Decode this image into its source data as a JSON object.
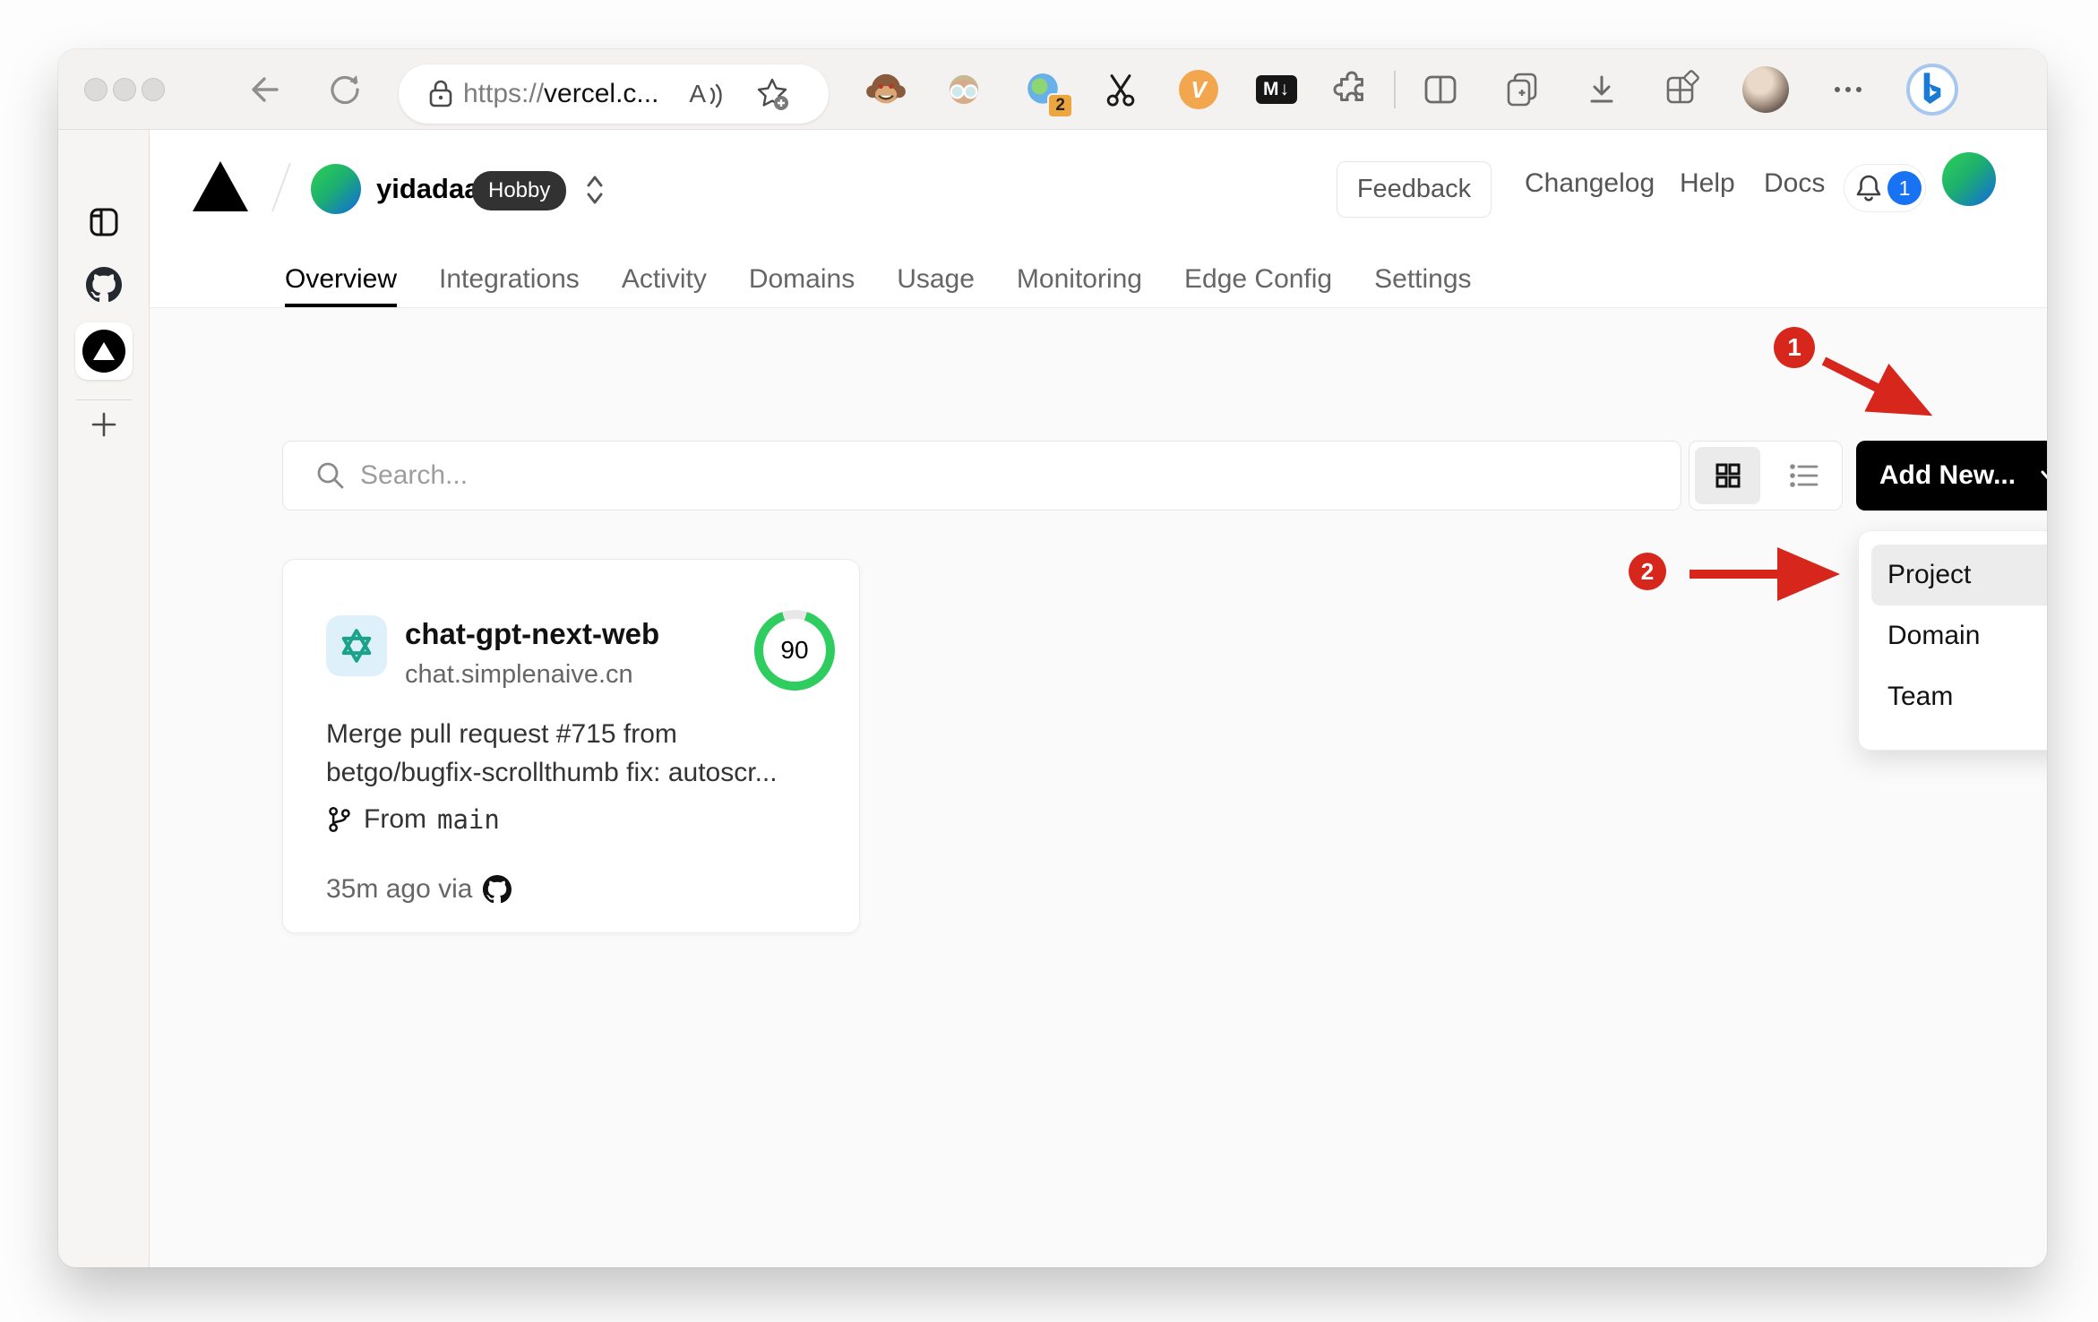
{
  "browser": {
    "url": {
      "scheme": "https://",
      "host": "vercel.c..."
    },
    "readaloud_glyph": "A",
    "ext_badge_count": "2",
    "vimium_glyph": "V",
    "markdown_glyph": "M↓"
  },
  "header": {
    "team_name": "yidadaa",
    "plan_badge": "Hobby",
    "feedback_label": "Feedback",
    "links": [
      {
        "label": "Changelog"
      },
      {
        "label": "Help"
      },
      {
        "label": "Docs"
      }
    ],
    "notification_count": "1"
  },
  "tabs": [
    {
      "label": "Overview",
      "active": true
    },
    {
      "label": "Integrations",
      "active": false
    },
    {
      "label": "Activity",
      "active": false
    },
    {
      "label": "Domains",
      "active": false
    },
    {
      "label": "Usage",
      "active": false
    },
    {
      "label": "Monitoring",
      "active": false
    },
    {
      "label": "Edge Config",
      "active": false
    },
    {
      "label": "Settings",
      "active": false
    }
  ],
  "toolbar": {
    "search_placeholder": "Search...",
    "add_new_label": "Add New..."
  },
  "dropdown": {
    "items": [
      {
        "label": "Project",
        "highlighted": true
      },
      {
        "label": "Domain",
        "highlighted": false
      },
      {
        "label": "Team",
        "highlighted": false
      }
    ]
  },
  "project_card": {
    "name": "chat-gpt-next-web",
    "domain": "chat.simplenaive.cn",
    "score": "90",
    "description": "Merge pull request #715 from betgo/bugfix-scrollthumb fix: autoscr...",
    "branch_prefix": "From",
    "branch_name": "main",
    "deployed": "35m ago via"
  },
  "annotations": {
    "step1": "1",
    "step2": "2"
  },
  "colors": {
    "accent_green": "#2fcd5f",
    "notification_blue": "#1772f4",
    "annotation_red": "#d7271d",
    "button_black": "#000000"
  }
}
